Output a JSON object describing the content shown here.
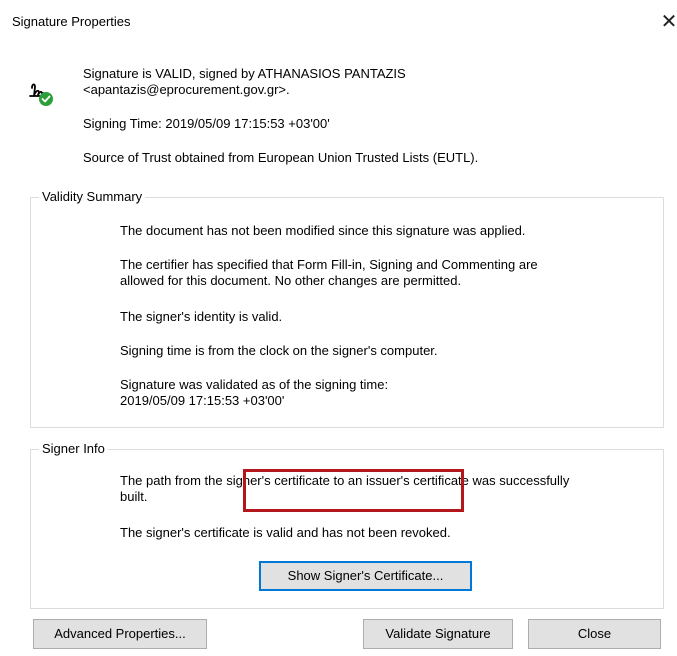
{
  "window": {
    "title": "Signature Properties",
    "close_glyph": "✕"
  },
  "header": {
    "icon": "signature-valid-icon",
    "status_line1": "Signature is VALID, signed by ATHANASIOS PANTAZIS",
    "status_line2": "<apantazis@eprocurement.gov.gr>.",
    "signing_time": "Signing Time:  2019/05/09 17:15:53 +03'00'",
    "source_of_trust": "Source of Trust obtained from European Union Trusted Lists (EUTL)."
  },
  "validity_summary": {
    "label": "Validity Summary",
    "not_modified": "The document has not been modified since this signature was applied.",
    "certifier_line1": "The certifier has specified that Form Fill-in, Signing and Commenting are",
    "certifier_line2": "allowed for this document. No other changes are permitted.",
    "identity_valid": "The signer's identity is valid.",
    "signing_time_source": "Signing time is from the clock on the signer's computer.",
    "validated_line1": "Signature was validated as of the signing time:",
    "validated_line2": "2019/05/09 17:15:53 +03'00'"
  },
  "signer_info": {
    "label": "Signer Info",
    "path_line1": "The path from the signer's certificate to an issuer's certificate was successfully",
    "path_line2": "built.",
    "cert_valid": "The signer's certificate is valid and has not been revoked.",
    "show_cert_button": "Show Signer's Certificate..."
  },
  "footer": {
    "advanced_button": "Advanced Properties...",
    "validate_button": "Validate Signature",
    "close_button": "Close"
  },
  "colors": {
    "check_green": "#2e9e3a",
    "highlight_red": "#b3161b",
    "default_button_border": "#0078d7"
  }
}
